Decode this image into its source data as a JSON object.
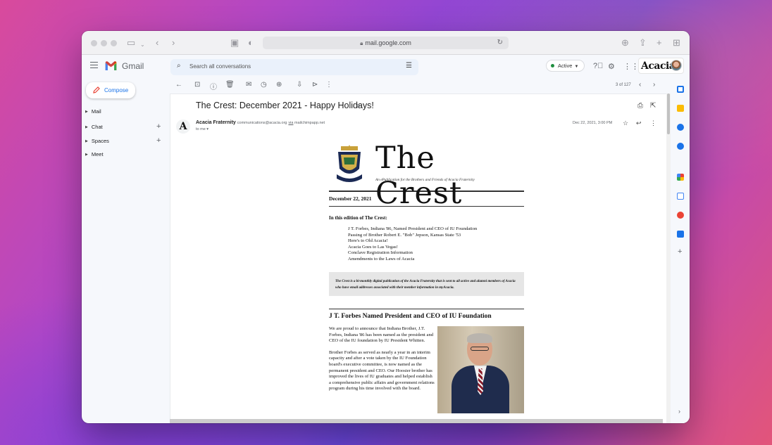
{
  "browser": {
    "url": "mail.google.com"
  },
  "gmail": {
    "brand": "Gmail",
    "search_placeholder": "Search all conversations",
    "status_label": "Active",
    "account_logo_text": "Acacia",
    "compose_label": "Compose",
    "nav": [
      {
        "label": "Mail"
      },
      {
        "label": "Chat"
      },
      {
        "label": "Spaces"
      },
      {
        "label": "Meet"
      }
    ],
    "pagination": "3 of 127"
  },
  "message": {
    "subject": "The Crest: December 2021 - Happy Holidays!",
    "sender_avatar_letter": "A",
    "sender_name": "Acacia Fraternity",
    "sender_email": "communications@acacia.org",
    "via_word": "via",
    "via_domain": "mailchimpapp.net",
    "to_line": "to me",
    "date": "Dec 22, 2021, 3:00 PM"
  },
  "newsletter": {
    "masthead": "The Crest",
    "tagline": "An ePublication for the Brothers and Friends of Acacia Fraternity",
    "issue_date": "December 22, 2021",
    "edition_heading": "In this edition of The Crest:",
    "edition_items": [
      "J T. Forbes, Indiana '86, Named President and CEO of IU Foundation",
      "Passing of Brother Robert E. \"Bob\" Jepson, Kansas State '53",
      "Here's to Old Acacia!",
      "Acacia Goes to Las Vegas!",
      "Conclave Registration Information",
      "Amendments to the Laws of Acacia"
    ],
    "notice": "The Crest is a bi-monthly digital publication of the Acacia Fraternity that is sent to all active and alumni members of Acacia who have email addresses associated with their member information in myAcacia.",
    "article_title": "J T. Forbes Named President and CEO of IU Foundation",
    "article_p1": "We are proud to announce that Indiana Brother, J.T. Forbes, Indiana '86 has been named as the president and CEO of the IU foundation by IU President Whitten.",
    "article_p2": "Brother Forbes as served as nearly a year in an interim capacity and after a vote taken by the IU Foundation board's executive committee, is now named as the permanent president and CEO. Our Hoosier brother has improved the lives of IU graduates and helped establish a comprehensive public affairs and government relations program during his time involved with the board."
  },
  "colors": {
    "gmail_blue": "#1a73e8",
    "active_green": "#1e8e3e"
  }
}
